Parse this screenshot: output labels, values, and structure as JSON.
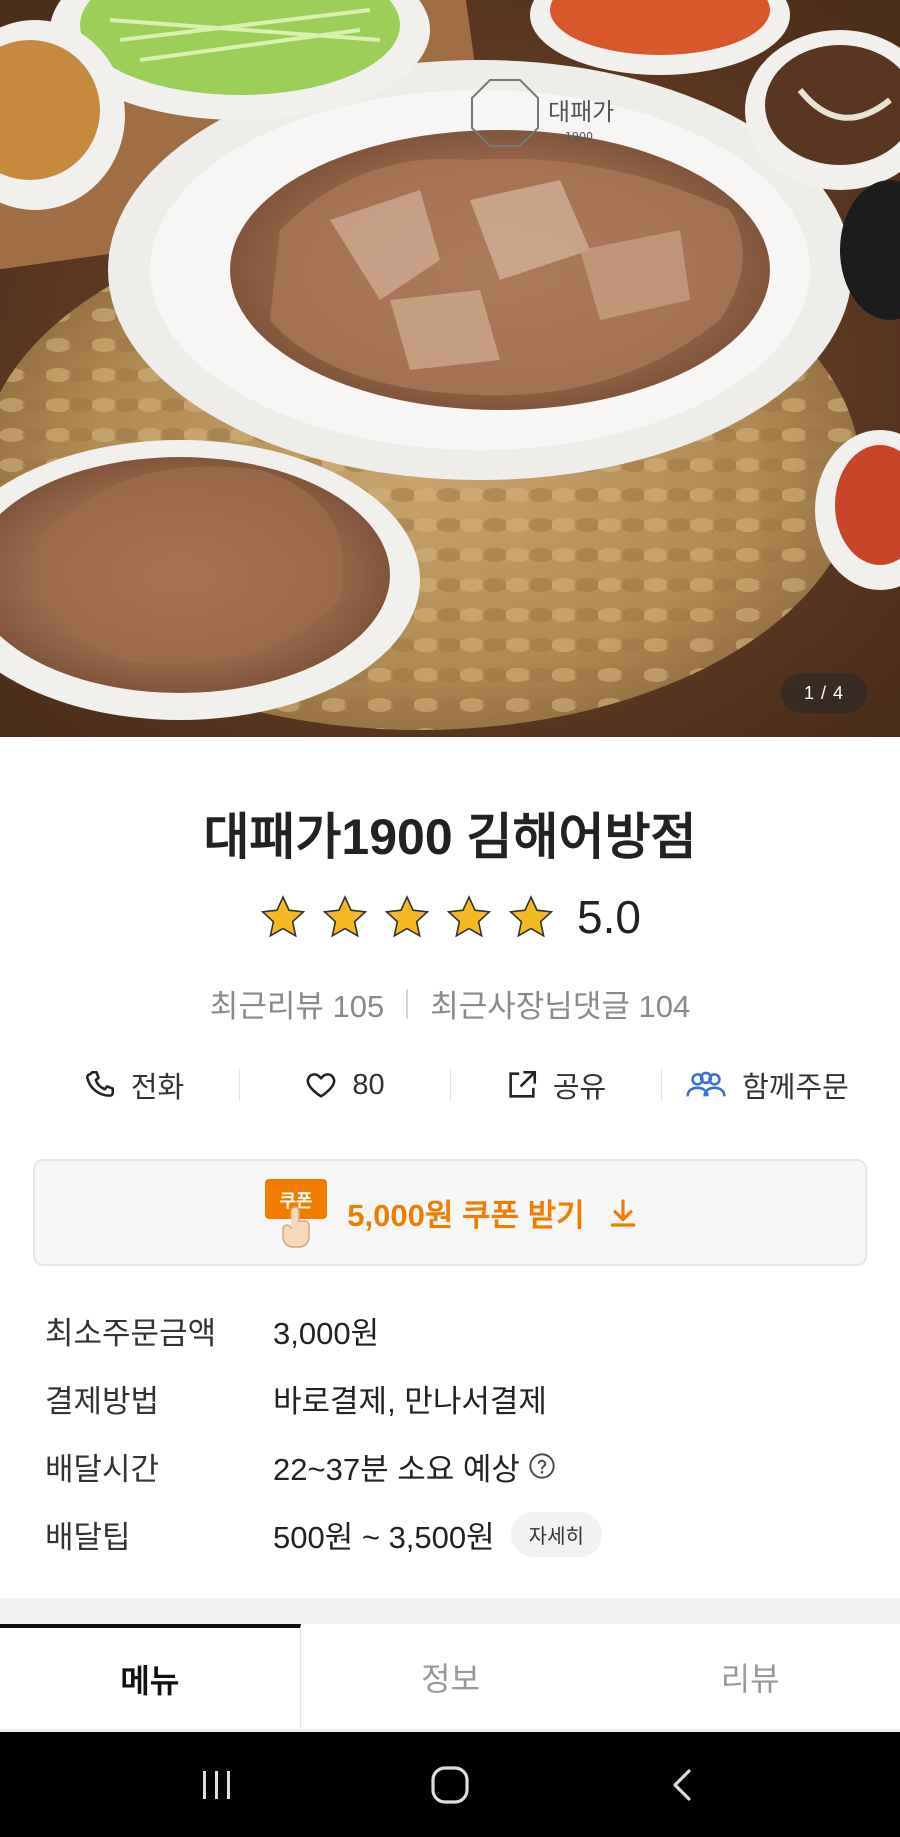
{
  "hero": {
    "image_counter": "1 / 4",
    "plate_logo_text": "대패가",
    "plate_logo_sub": "1900"
  },
  "store": {
    "name": "대패가1900 김해어방점",
    "rating_value": "5.0",
    "rating_stars": 5,
    "recent_reviews": "최근리뷰 105",
    "recent_owner_replies": "최근사장님댓글 104"
  },
  "actions": {
    "call_label": "전화",
    "like_count": "80",
    "share_label": "공유",
    "group_order_label": "함께주문"
  },
  "coupon": {
    "badge_text": "쿠폰",
    "label": "5,000원 쿠폰 받기"
  },
  "info": {
    "min_order_label": "최소주문금액",
    "min_order_value": "3,000원",
    "payment_label": "결제방법",
    "payment_value": "바로결제, 만나서결제",
    "delivery_time_label": "배달시간",
    "delivery_time_value": "22~37분 소요 예상",
    "delivery_tip_label": "배달팁",
    "delivery_tip_value": "500원 ~ 3,500원",
    "detail_button": "자세히"
  },
  "tabs": [
    {
      "label": "메뉴",
      "active": true
    },
    {
      "label": "정보",
      "active": false
    },
    {
      "label": "리뷰",
      "active": false
    }
  ],
  "colors": {
    "accent_orange": "#f07d00",
    "star_yellow": "#f5b921",
    "group_order_blue": "#3b6fd8"
  }
}
